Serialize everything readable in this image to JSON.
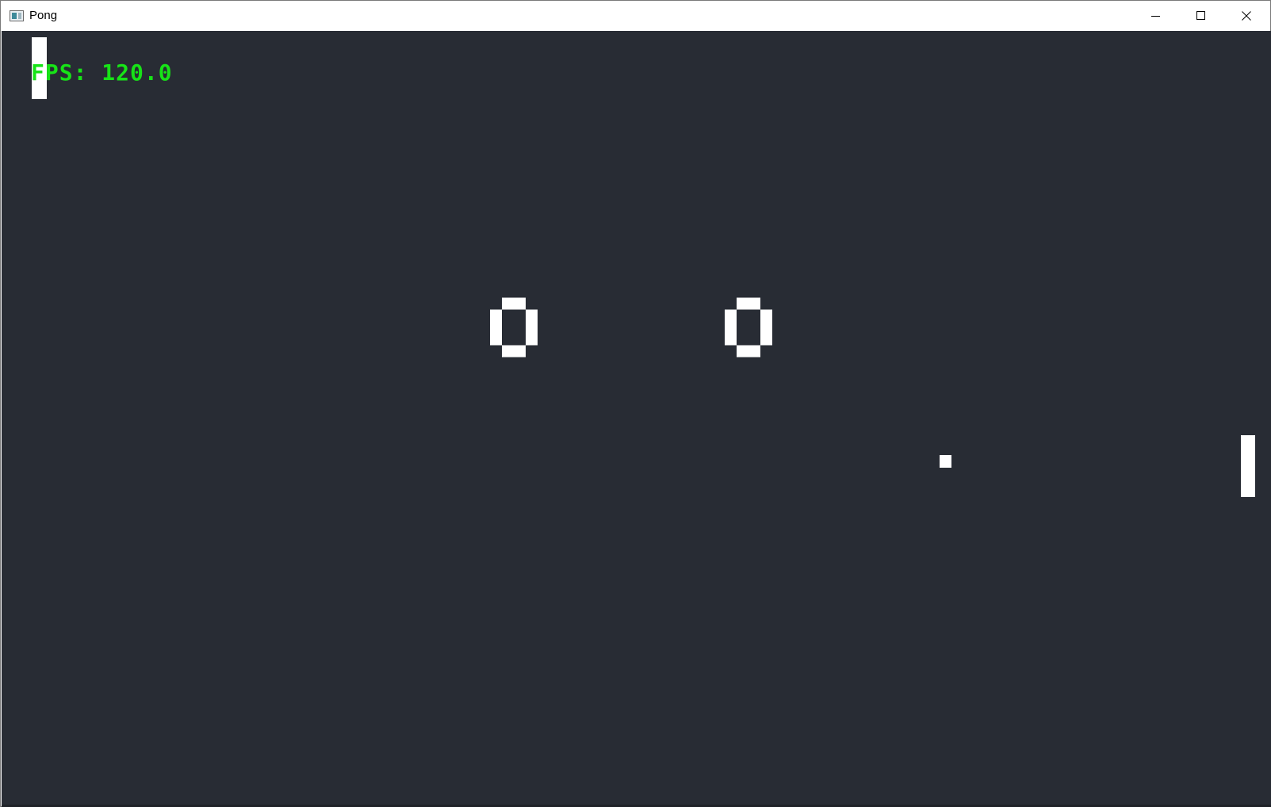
{
  "window": {
    "title": "Pong",
    "icon": "app-window-icon",
    "controls": [
      "minimize-icon",
      "maximize-icon",
      "close-icon"
    ]
  },
  "game": {
    "background": "#282c34",
    "fps_text": "FPS: 120.0",
    "fps_color": "#17e317",
    "score_left": "0",
    "score_right": "0",
    "foreground": "#ffffff"
  }
}
